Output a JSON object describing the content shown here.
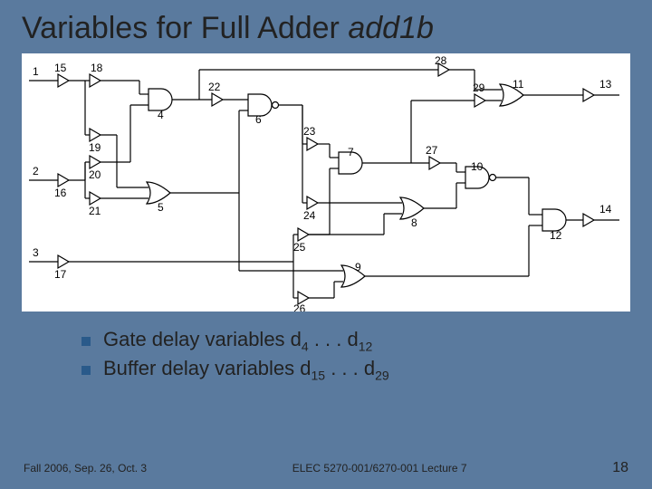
{
  "title_plain": "Variables for Full Adder ",
  "title_italic": "add1b",
  "bullets": [
    {
      "prefix": "Gate delay variables d",
      "sub1": "4",
      "mid": " . . . d",
      "sub2": "12"
    },
    {
      "prefix": "Buffer delay variables d",
      "sub1": "15",
      "mid": " . . . d",
      "sub2": "29"
    }
  ],
  "footer": {
    "left": "Fall 2006, Sep. 26, Oct. 3",
    "center": "ELEC 5270-001/6270-001 Lecture 7",
    "page": "18"
  },
  "circuit_labels": {
    "inputs": [
      "1",
      "2",
      "3"
    ],
    "input_bufs": [
      "15",
      "16",
      "17"
    ],
    "fanout_bufs": [
      "18",
      "19",
      "20",
      "21"
    ],
    "gates": [
      "4",
      "5",
      "6",
      "7",
      "8",
      "9",
      "10",
      "11",
      "12"
    ],
    "mid_bufs": [
      "22",
      "23",
      "24",
      "25",
      "26",
      "27",
      "28",
      "29"
    ],
    "outputs": [
      "13",
      "14"
    ]
  }
}
